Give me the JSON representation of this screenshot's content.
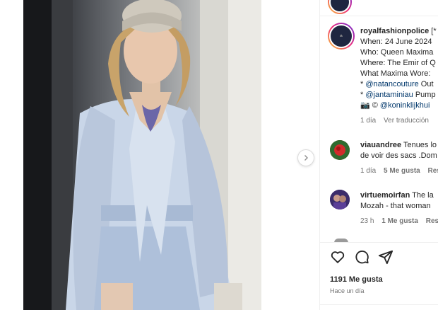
{
  "post": {
    "author": "royalfashionpolice",
    "author_suffix": "[*",
    "caption_lines": [
      "When: 24 June 2024",
      "Who: Queen Maxima",
      "Where: The Emir of Q",
      "What Maxima Wore:"
    ],
    "credits": [
      {
        "prefix": "* ",
        "handle": "@natancouture",
        "rest": " Out"
      },
      {
        "prefix": "* ",
        "handle": "@jantaminiau",
        "rest": " Pump"
      },
      {
        "prefix": "📷 © ",
        "handle": "@koninklijkhui",
        "rest": ""
      }
    ],
    "time": "1 día",
    "translate": "Ver traducción"
  },
  "comments": [
    {
      "user": "viauandree",
      "text_1": "Tenues lo",
      "text_2": "de voir des sacs .Dom",
      "time": "1 día",
      "likes": "5 Me gusta",
      "reply": "Res"
    },
    {
      "user": "virtuemoirfan",
      "text_1": "The la",
      "text_2": "Mozah - that woman",
      "time": "23 h",
      "likes": "1 Me gusta",
      "reply": "Resp"
    }
  ],
  "footer": {
    "likes": "1191 Me gusta",
    "date": "Hace un día"
  },
  "icons": {
    "like": "heart-icon",
    "comment": "comment-icon",
    "share": "send-icon",
    "next": "chevron-right-icon"
  },
  "colors": {
    "link": "#00376b",
    "meta": "#737373",
    "text": "#262626"
  }
}
